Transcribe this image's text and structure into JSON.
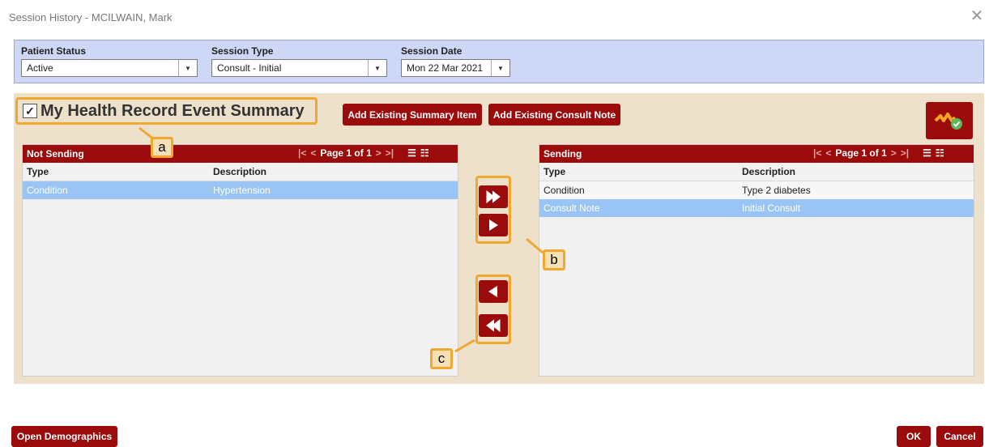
{
  "window": {
    "title": "Session History - MCILWAIN, Mark"
  },
  "filters": {
    "patient_status": {
      "label": "Patient Status",
      "value": "Active"
    },
    "session_type": {
      "label": "Session Type",
      "value": "Consult - Initial"
    },
    "session_date": {
      "label": "Session Date",
      "value": "Mon 22 Mar 2021"
    }
  },
  "summary": {
    "checkbox_label": "My Health Record Event Summary",
    "add_summary_label": "Add Existing Summary Item",
    "add_consult_label": "Add Existing Consult Note"
  },
  "not_sending": {
    "title": "Not Sending",
    "pager": "Page 1 of 1",
    "columns": [
      "Type",
      "Description"
    ],
    "rows": [
      {
        "type": "Condition",
        "description": "Hypertension",
        "selected": true
      }
    ]
  },
  "sending": {
    "title": "Sending",
    "pager": "Page 1 of 1",
    "columns": [
      "Type",
      "Description"
    ],
    "rows": [
      {
        "type": "Condition",
        "description": "Type 2 diabetes",
        "selected": false
      },
      {
        "type": "Consult Note",
        "description": "Initial Consult",
        "selected": true
      }
    ]
  },
  "callouts": {
    "a": "a",
    "b": "b",
    "c": "c"
  },
  "footer": {
    "open_demographics": "Open Demographics",
    "ok": "OK",
    "cancel": "Cancel"
  },
  "colors": {
    "accent": "#9b0b0b",
    "highlight": "#f0a830",
    "selection": "#99c4f3",
    "filter_bg": "#cfd7f6",
    "panel_bg": "#ede1cc"
  }
}
